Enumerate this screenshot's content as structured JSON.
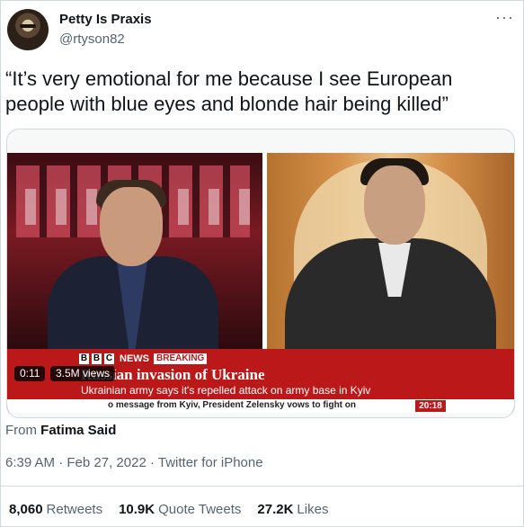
{
  "tweet": {
    "display_name": "Petty Is Praxis",
    "handle": "@rtyson82",
    "more_icon": "more-horizontal-icon",
    "text": "“It’s very emotional for me because I see European people with blue eyes and blonde hair being killed”",
    "from_label": "From",
    "from_name": "Fatima Said",
    "time": "6:39 AM",
    "date": "Feb 27, 2022",
    "source": "Twitter for iPhone"
  },
  "video": {
    "elapsed": "0:11",
    "views": "3.5M views",
    "broadcast": {
      "bbc_letters": [
        "B",
        "B",
        "C"
      ],
      "news_label": "NEWS",
      "breaking_label": "BREAKING",
      "headline": "Russian invasion of Ukraine",
      "subheadline": "Ukrainian army says it's repelled attack on army base in Kyiv",
      "ticker": "o message from Kyiv, President Zelensky vows to fight on",
      "clock": "20:18"
    }
  },
  "stats": {
    "retweets_count": "8,060",
    "retweets_label": "Retweets",
    "quotes_count": "10.9K",
    "quotes_label": "Quote Tweets",
    "likes_count": "27.2K",
    "likes_label": "Likes"
  },
  "colors": {
    "text_primary": "#0f1419",
    "text_secondary": "#536471",
    "border": "#cfd9de",
    "bbc_red": "#bb1919"
  }
}
